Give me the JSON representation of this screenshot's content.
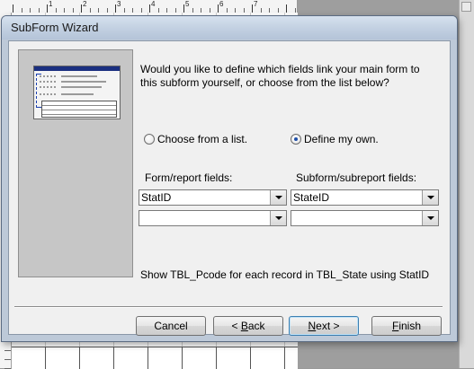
{
  "background": {
    "ruler_numbers": [
      "1",
      "2",
      "3",
      "4",
      "5",
      "6",
      "7"
    ]
  },
  "dialog": {
    "title": "SubForm Wizard",
    "question": "Would you like to define which fields link your main form to this subform yourself, or choose from the list below?",
    "options": [
      {
        "label": "Choose from a list.",
        "checked": false
      },
      {
        "label": "Define my own.",
        "checked": true
      }
    ],
    "form_fields_label": "Form/report fields:",
    "subform_fields_label": "Subform/subreport fields:",
    "form_fields": [
      "StatID",
      ""
    ],
    "subform_fields": [
      "StateID",
      ""
    ],
    "summary": "Show TBL_Pcode for each record in TBL_State using StatID",
    "buttons": {
      "cancel": "Cancel",
      "back_prefix": "< ",
      "back_key": "B",
      "back_rest": "ack",
      "next_prefix": "",
      "next_key": "N",
      "next_rest": "ext >",
      "finish_key": "F",
      "finish_rest": "inish"
    },
    "colors": {
      "accent": "#1f4fa8",
      "title_bar": "#c3d1e2"
    }
  }
}
